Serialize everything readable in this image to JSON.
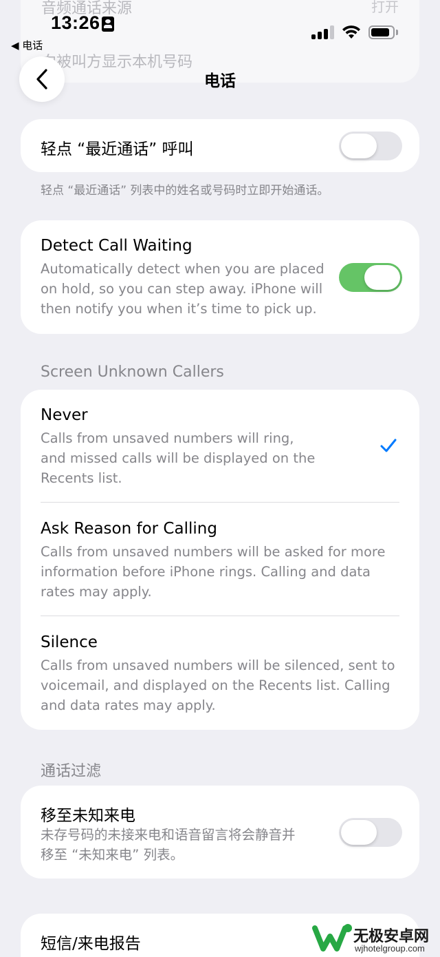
{
  "status_bar": {
    "time": "13:26",
    "back_app": "◀ 电话"
  },
  "ghost": {
    "row1_label": "音频通话来源",
    "row1_value": "打开",
    "row2_label": "向被叫方显示本机号码"
  },
  "nav": {
    "title": "电话"
  },
  "tap_recents": {
    "label": "轻点 “最近通话” 呼叫",
    "footnote": "轻点 “最近通话” 列表中的姓名或号码时立即开始通话。",
    "enabled": false
  },
  "detect_waiting": {
    "title": "Detect Call Waiting",
    "sub1": "Automatically detect when you are placed",
    "sub2": "on hold, so you can step away. iPhone will",
    "sub3": "then notify you when it’s time to pick up.",
    "enabled": true
  },
  "screen_unknown": {
    "header": "Screen Unknown Callers",
    "options": [
      {
        "title": "Never",
        "lines": [
          "Calls from unsaved numbers will ring,",
          "and missed calls will be displayed on the",
          "Recents list."
        ],
        "selected": true
      },
      {
        "title": "Ask Reason for Calling",
        "lines": [
          "Calls from unsaved numbers will be asked for more",
          "information before iPhone rings. Calling and data",
          "rates may apply."
        ],
        "selected": false
      },
      {
        "title": "Silence",
        "lines": [
          "Calls from unsaved numbers will be silenced, sent to",
          "voicemail, and displayed on the Recents list. Calling",
          "and data rates may apply."
        ],
        "selected": false
      }
    ]
  },
  "call_filter": {
    "header": "通话过滤",
    "title": "移至未知来电",
    "sub1": "未存号码的未接来电和语音留言将会静音并",
    "sub2": "移至 “未知来电” 列表。",
    "enabled": false
  },
  "sms_report": {
    "title": "短信/来电报告"
  },
  "watermark": {
    "name": "无极安卓网",
    "url": "wjhotelgroup.com"
  },
  "colors": {
    "accent": "#007aff",
    "toggle_on": "#65c466",
    "background": "#efeff4"
  }
}
